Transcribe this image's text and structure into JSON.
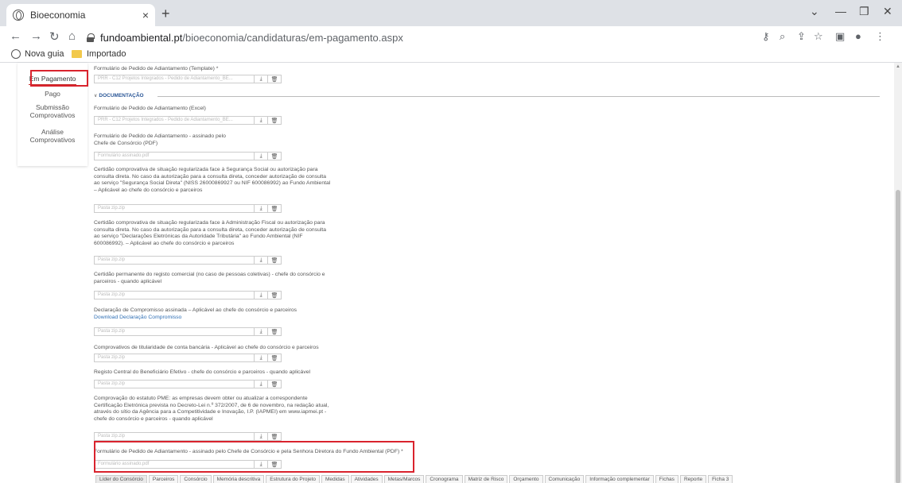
{
  "browser": {
    "tab_title": "Bioeconomia",
    "tab_close": "×",
    "new_tab": "+",
    "url_domain": "fundoambiental.pt",
    "url_path": "/bioeconomia/candidaturas/em-pagamento.aspx",
    "bookmarks": [
      "Nova guia",
      "Importado"
    ]
  },
  "sidebar": {
    "items": [
      {
        "label": "Em Pagamento",
        "active": true
      },
      {
        "label": "Pago"
      },
      {
        "label": "Submissão Comprovativos"
      },
      {
        "label": "Análise Comprovativos"
      }
    ]
  },
  "form": {
    "template_label": "Formulário de Pedido de Adiantamento (Template) *",
    "template_file": "PRR - C12 Projetos Integrados - Pedido de Adiantamento_BE...",
    "section_title": "DOCUMENTAÇÃO",
    "fields": [
      {
        "label": "Formulário de Pedido de Adiantamento (Excel)",
        "file": "PRR - C12 Projetos Integrados - Pedido de Adiantamento_BE..."
      },
      {
        "label": "Formulário de Pedido de Adiantamento - assinado pelo Chefe de Consórcio (PDF)",
        "file": "Formulário assinado.pdf"
      },
      {
        "label": "Certidão comprovativa de situação regularizada face à Segurança Social ou autorização para consulta direta. No caso da autorização para a consulta direta, conceder autorização de consulta ao serviço \"Segurança Social Direta\" (NISS 26000869927 ou NIF 600086992) ao Fundo Ambiental – Aplicável ao chefe do consórcio e parceiros",
        "file": "Pasta zip.zip"
      },
      {
        "label": "Certidão comprovativa de situação regularizada face à Administração Fiscal ou autorização para consulta direta. No caso da autorização para a consulta direta, conceder autorização de consulta ao serviço \"Declarações Eletrónicas da Autoridade Tributária\" ao Fundo Ambiental (NIF 600086992). – Aplicável ao chefe do consórcio e parceiros",
        "file": "Pasta zip.zip"
      },
      {
        "label": "Certidão permanente do registo comercial (no caso de pessoas coletivas) - chefe do consórcio e parceiros - quando aplicável",
        "file": "Pasta zip.zip"
      },
      {
        "label": "Declaração de Compromisso assinada – Aplicável ao chefe do consórcio e parceiros",
        "link": "Download Declaração Compromisso",
        "file": "Pasta zip.zip"
      },
      {
        "label": "Comprovativos de titularidade de conta bancária - Aplicável ao chefe do consórcio e parceiros",
        "file": "Pasta zip.zip"
      },
      {
        "label": "Registo Central do Beneficiário Efetivo - chefe do consórcio e parceiros - quando aplicável",
        "file": "Pasta zip.zip"
      },
      {
        "label": "Comprovação do estatuto PME: as empresas devem obter ou atualizar a correspondente Certificação Eletrónica prevista no Decreto-Lei n.º 372/2007, de 6 de novembro, na redação atual, através do sítio da Agência para a Competitividade e Inovação, I.P. (IAPMEI) em www.iapmei.pt - chefe do consórcio e parceiros - quando aplicável",
        "file": "Pasta zip.zip"
      },
      {
        "label": "Formulário de Pedido de Adiantamento - assinado pelo Chefe de Consórcio e pela Senhora Diretora do Fundo Ambiental (PDF) *",
        "file": "Formulário assinado.pdf"
      }
    ]
  },
  "page_tabs": [
    "Líder do Consórcio",
    "Parceiros",
    "Consórcio",
    "Memória descritiva",
    "Estrutura do Projeto",
    "Medidas",
    "Atividades",
    "Metas/Marcos",
    "Cronograma",
    "Matriz de Risco",
    "Orçamento",
    "Comunicação",
    "Informação complementar",
    "Fichas",
    "Reporte",
    "Ficha 3"
  ],
  "colors": {
    "highlight": "#d9232d",
    "section": "#2b5797",
    "link": "#2f6fb5"
  }
}
